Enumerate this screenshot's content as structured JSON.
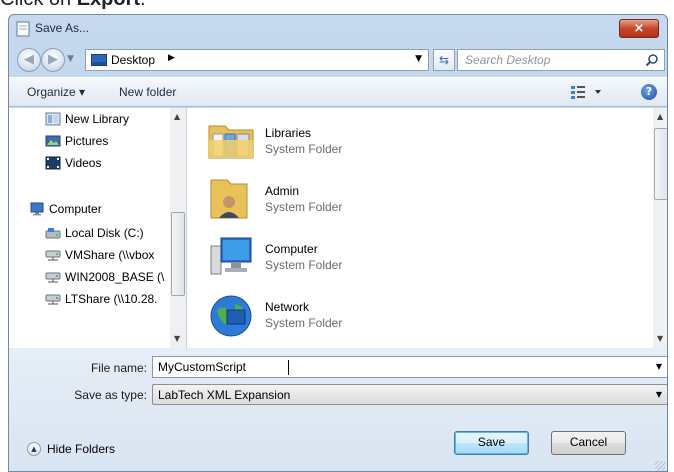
{
  "instruction": {
    "prefix": "Click on ",
    "bold": "Export",
    "suffix": "."
  },
  "window": {
    "title": "Save As...",
    "close_label": "×"
  },
  "address_bar": {
    "path": "Desktop",
    "search_placeholder": "Search Desktop"
  },
  "toolbar": {
    "organize_label": "Organize ▾",
    "new_folder_label": "New folder"
  },
  "nav_pane": {
    "items": [
      {
        "label": "New Library",
        "icon": "library-icon"
      },
      {
        "label": "Pictures",
        "icon": "pictures-icon"
      },
      {
        "label": "Videos",
        "icon": "videos-icon"
      },
      {
        "label": "Computer",
        "icon": "computer-icon"
      },
      {
        "label": "Local Disk (C:)",
        "icon": "disk-icon"
      },
      {
        "label": "VMShare (\\\\vbox",
        "icon": "network-drive-icon"
      },
      {
        "label": "WIN2008_BASE (\\",
        "icon": "network-drive-icon"
      },
      {
        "label": "LTShare (\\\\10.28.",
        "icon": "network-drive-icon"
      }
    ]
  },
  "files": [
    {
      "name": "Libraries",
      "type": "System Folder",
      "icon": "libraries-folder-icon"
    },
    {
      "name": "Admin",
      "type": "System Folder",
      "icon": "user-folder-icon"
    },
    {
      "name": "Computer",
      "type": "System Folder",
      "icon": "computer-large-icon"
    },
    {
      "name": "Network",
      "type": "System Folder",
      "icon": "network-globe-icon"
    }
  ],
  "form": {
    "file_name_label": "File name:",
    "file_name_value": "MyCustomScript",
    "save_type_label": "Save as type:",
    "save_type_value": "LabTech XML Expansion"
  },
  "footer": {
    "hide_folders_label": "Hide Folders",
    "save_label": "Save",
    "cancel_label": "Cancel"
  }
}
